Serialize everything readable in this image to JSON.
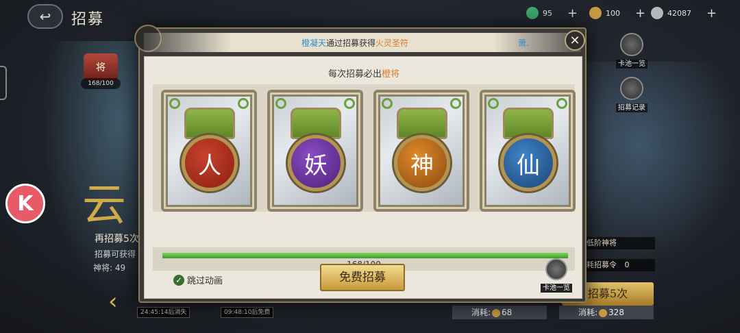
{
  "header": {
    "title": "招募",
    "currencies": [
      {
        "icon": "jade-icon",
        "value": "95",
        "color": "#3fa86a"
      },
      {
        "icon": "coin-icon",
        "value": "100",
        "color": "#c79a43"
      },
      {
        "icon": "silver-icon",
        "value": "42087",
        "color": "#b8b8b8"
      }
    ]
  },
  "left_panel": {
    "fire_badge": "将",
    "progress": "168/100",
    "big_char": "云",
    "recruit_again": "再招募5次",
    "recruit_obtain": "招募可获得",
    "god_general": "神将: 49",
    "timers": [
      "24:45:14后消失",
      "09:48:10后免费"
    ]
  },
  "right_panel": {
    "pool_overview": "卡池一览",
    "recruit_record": "招募记录",
    "low_tier": "低阶神将",
    "consume_order": "耗招募令",
    "consume_order_value": "0",
    "recruit5": "招募5次",
    "costs": [
      {
        "label": "消耗:",
        "value": "68"
      },
      {
        "label": "消耗:",
        "value": "328"
      }
    ]
  },
  "modal": {
    "marquee": {
      "name": "橙凝天",
      "middle": "通过招募获得",
      "item": "火灵圣符",
      "extra": "萧."
    },
    "subtitle_prefix": "每次招募必出",
    "subtitle_highlight": "橙将",
    "cards": [
      {
        "glyph": "人",
        "color": "#c7422a",
        "glow": "#8b1f14"
      },
      {
        "glyph": "妖",
        "color": "#8a4bc4",
        "glow": "#4e2379"
      },
      {
        "glyph": "神",
        "color": "#e08a2a",
        "glow": "#8a4a10"
      },
      {
        "glyph": "仙",
        "color": "#3f83c8",
        "glow": "#1c4577"
      }
    ],
    "progress": {
      "text": "168/100",
      "fraction": 1.0
    },
    "skip_label": "跳过动画",
    "free_recruit_label": "免费招募",
    "pool_overview_label": "卡池一览",
    "close_glyph": "✕"
  }
}
